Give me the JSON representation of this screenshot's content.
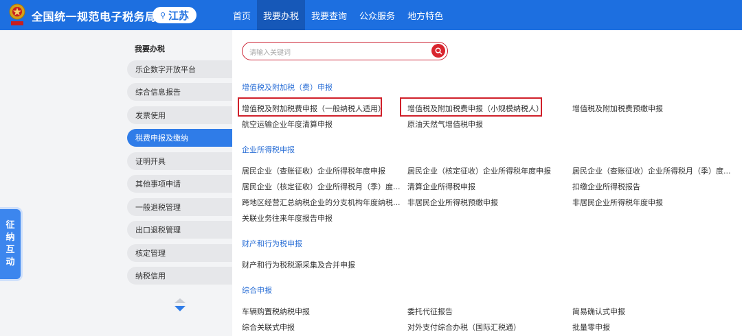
{
  "header": {
    "site_title": "全国统一规范电子税务局",
    "region": "江苏",
    "nav": [
      "首页",
      "我要办税",
      "我要查询",
      "公众服务",
      "地方特色"
    ],
    "active_nav": 1,
    "brand_color": "#1d6fe0"
  },
  "sidebar": {
    "heading": "我要办税",
    "items": [
      "乐企数字开放平台",
      "综合信息报告",
      "发票使用",
      "税费申报及缴纳",
      "证明开具",
      "其他事项申请",
      "一般退税管理",
      "出口退税管理",
      "核定管理",
      "纳税信用"
    ],
    "active_index": 3
  },
  "float_tab": [
    "征",
    "纳",
    "互",
    "动"
  ],
  "search": {
    "placeholder": "请输入关键词"
  },
  "sections": [
    {
      "title": "增值税及附加税（费）申报",
      "rows": [
        [
          "增值税及附加税费申报（一般纳税人适用）",
          "增值税及附加税费申报（小规模纳税人）",
          "增值税及附加税费预缴申报"
        ],
        [
          "航空运输企业年度清算申报",
          "原油天然气增值税申报"
        ]
      ]
    },
    {
      "title": "企业所得税申报",
      "rows": [
        [
          "居民企业（查账征收）企业所得税年度申报",
          "居民企业（核定征收）企业所得税年度申报",
          "居民企业（查账征收）企业所得税月（季）度..."
        ],
        [
          "居民企业（核定征收）企业所得税月（季）度...",
          "清算企业所得税申报",
          "扣缴企业所得税报告"
        ],
        [
          "跨地区经营汇总纳税企业的分支机构年度纳税...",
          "非居民企业所得税预缴申报",
          "非居民企业所得税年度申报"
        ],
        [
          "关联业务往来年度报告申报"
        ]
      ]
    },
    {
      "title": "财产和行为税申报",
      "rows": [
        [
          "财产和行为税税源采集及合并申报"
        ]
      ]
    },
    {
      "title": "综合申报",
      "rows": [
        [
          "车辆购置税纳税申报",
          "委托代征报告",
          "简易确认式申报"
        ],
        [
          "综合关联式申报",
          "对外支付综合办税（国际汇税通）",
          "批量零申报"
        ]
      ]
    }
  ],
  "accent_red": "#d0202a"
}
